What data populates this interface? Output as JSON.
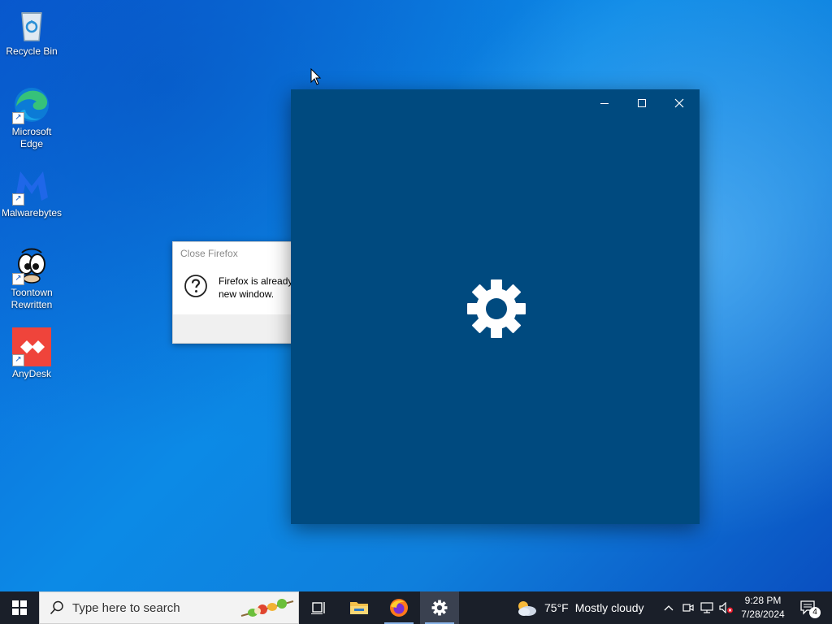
{
  "desktop": {
    "icons": [
      {
        "label": "Recycle Bin"
      },
      {
        "label": "Microsoft Edge"
      },
      {
        "label": "Malwarebytes"
      },
      {
        "label": "Toontown Rewritten"
      },
      {
        "label": "AnyDesk"
      }
    ]
  },
  "dialog": {
    "title": "Close Firefox",
    "message_line1": "Firefox is already",
    "message_line2": "new window."
  },
  "settings_window": {
    "icon": "gear-icon",
    "background": "#004a7f"
  },
  "taskbar": {
    "search_placeholder": "Type here to search",
    "weather_temp": "75°F",
    "weather_desc": "Mostly cloudy",
    "time": "9:28 PM",
    "date": "7/28/2024",
    "notification_count": "4",
    "pinned": [
      "task-view-icon",
      "file-explorer-icon",
      "firefox-icon",
      "settings-icon"
    ]
  }
}
